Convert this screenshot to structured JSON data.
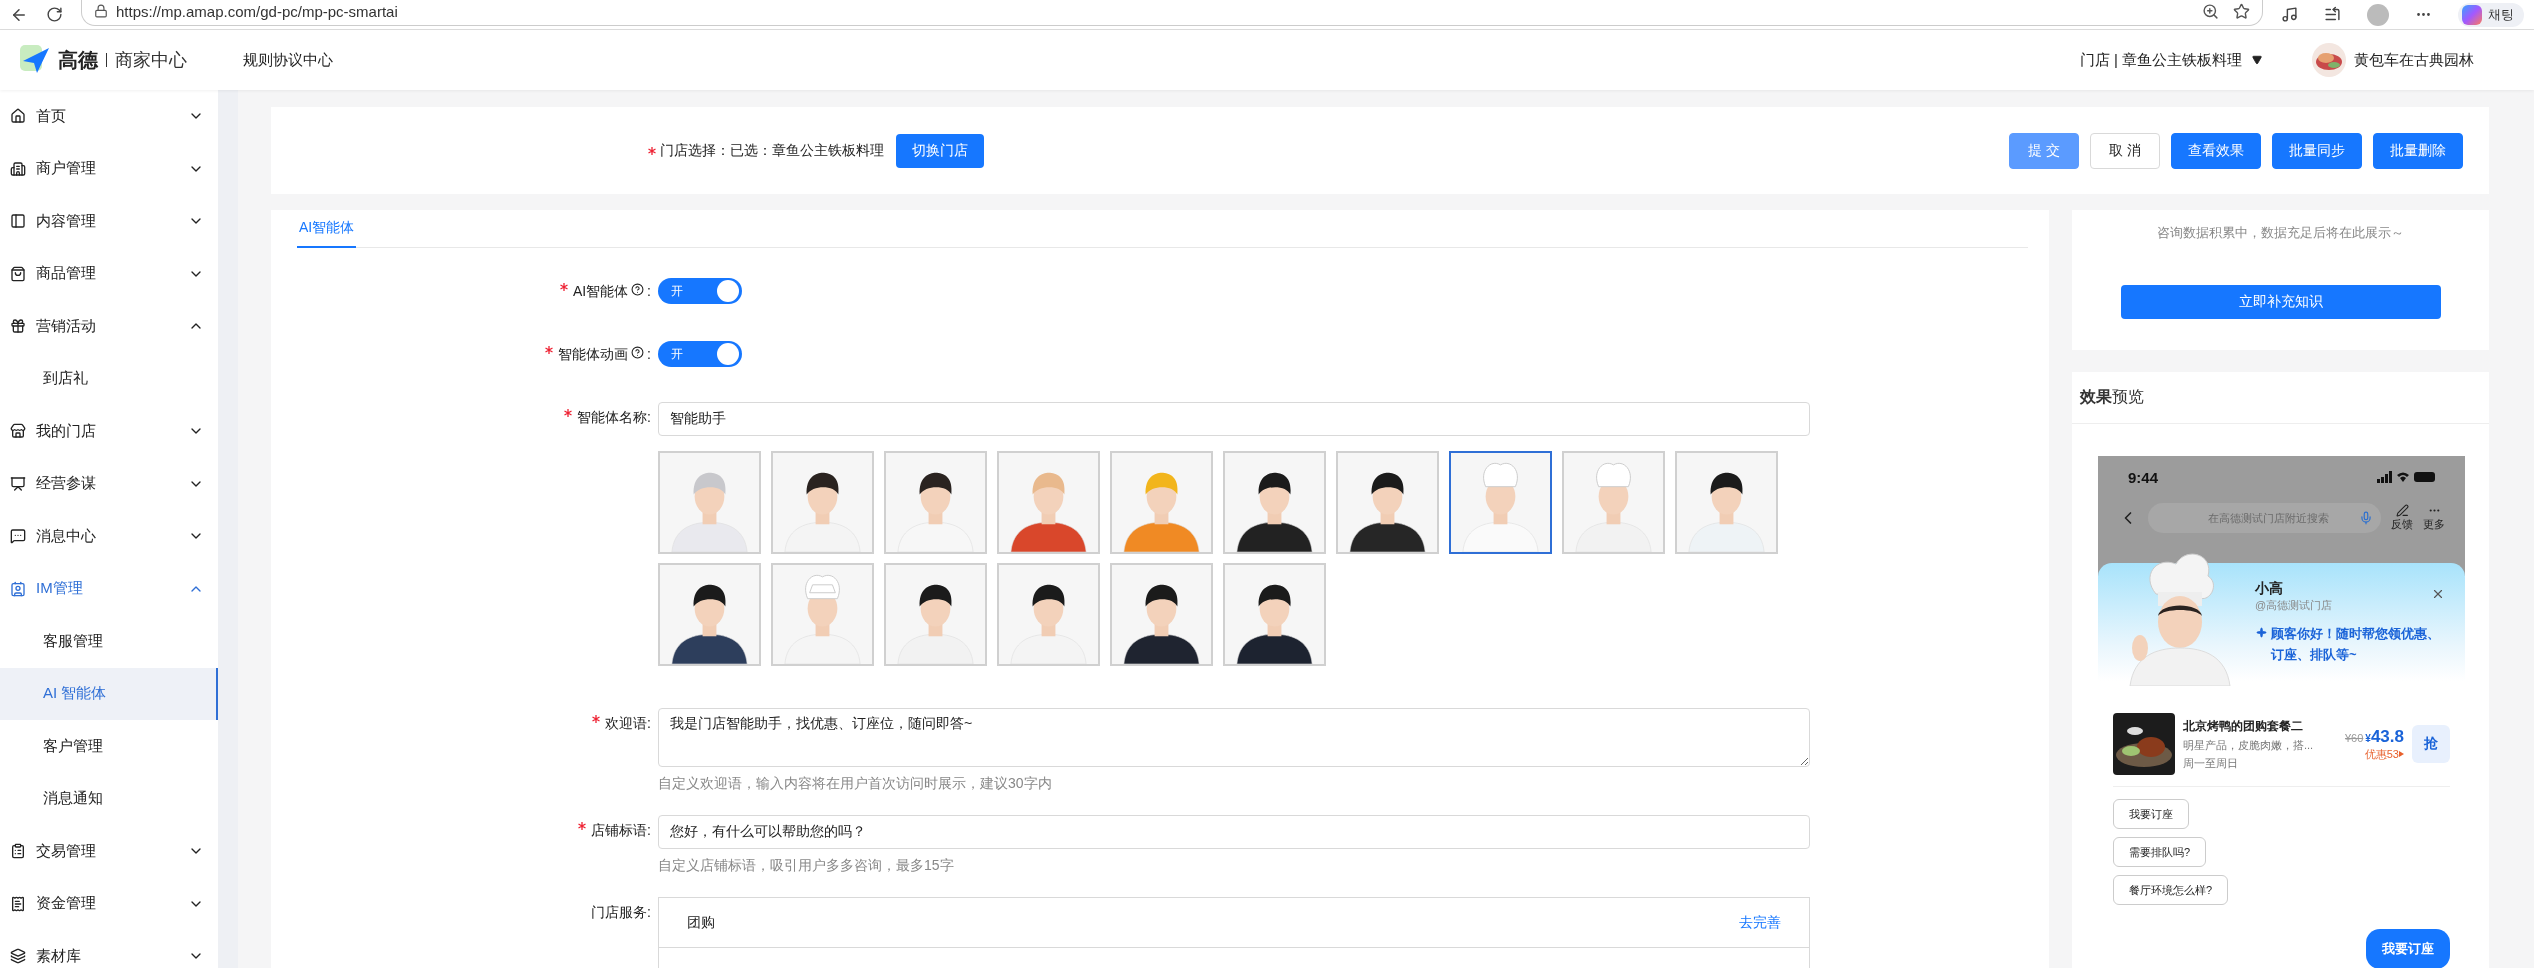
{
  "browser": {
    "url": "https://mp.amap.com/gd-pc/mp-pc-smartai",
    "chat_label": "채팅"
  },
  "header": {
    "brand": "高德",
    "product": "商家中心",
    "nav_link": "规则协议中心",
    "store_switch": {
      "label": "门店 | 章鱼公主铁板料理",
      "expanded": false
    },
    "user_name": "黄包车在古典园林"
  },
  "sidebar": {
    "items": [
      {
        "label": "首页",
        "expanded": false
      },
      {
        "label": "商户管理",
        "expanded": false
      },
      {
        "label": "内容管理",
        "expanded": false
      },
      {
        "label": "商品管理",
        "expanded": false
      },
      {
        "label": "营销活动",
        "expanded": true,
        "children": [
          {
            "label": "到店礼",
            "selected": false
          }
        ]
      },
      {
        "label": "我的门店",
        "expanded": false
      },
      {
        "label": "经营参谋",
        "expanded": false
      },
      {
        "label": "消息中心",
        "expanded": false
      },
      {
        "label": "IM管理",
        "expanded": true,
        "children": [
          {
            "label": "客服管理",
            "selected": false
          },
          {
            "label": "AI 智能体",
            "selected": true
          },
          {
            "label": "客户管理",
            "selected": false
          },
          {
            "label": "消息通知",
            "selected": false
          }
        ]
      },
      {
        "label": "交易管理",
        "expanded": false
      },
      {
        "label": "资金管理",
        "expanded": false
      },
      {
        "label": "素材库",
        "expanded": false
      }
    ]
  },
  "store_bar": {
    "required": true,
    "label": "门店选择：",
    "value": "已选：章鱼公主铁板料理",
    "switch_button": "切换门店",
    "actions": [
      {
        "label": "提 交",
        "kind": "light"
      },
      {
        "label": "取 消",
        "kind": "default"
      },
      {
        "label": "查看效果",
        "kind": "primary"
      },
      {
        "label": "批量同步",
        "kind": "primary"
      },
      {
        "label": "批量删除",
        "kind": "primary"
      }
    ]
  },
  "tabs": [
    {
      "label": "AI智能体",
      "selected": true
    }
  ],
  "form": {
    "toggles": [
      {
        "label": "AI智能体",
        "suffix": ":",
        "required": true,
        "on": true,
        "on_text": "开"
      },
      {
        "label": "智能体动画",
        "suffix": ":",
        "required": true,
        "on": true,
        "on_text": "开"
      }
    ],
    "name": {
      "label": "智能体名称:",
      "required": true,
      "value": "智能助手"
    },
    "avatars": [
      {
        "selected": false
      },
      {
        "selected": false
      },
      {
        "selected": false
      },
      {
        "selected": false
      },
      {
        "selected": false
      },
      {
        "selected": false
      },
      {
        "selected": false
      },
      {
        "selected": true
      },
      {
        "selected": false
      },
      {
        "selected": false
      },
      {
        "selected": false
      },
      {
        "selected": false
      },
      {
        "selected": false
      },
      {
        "selected": false
      },
      {
        "selected": false
      },
      {
        "selected": false
      }
    ],
    "welcome": {
      "label": "欢迎语:",
      "required": true,
      "value": "我是门店智能助手，找优惠、订座位，随问即答~",
      "hint": "自定义欢迎语，输入内容将在用户首次访问时展示，建议30字内"
    },
    "slogan": {
      "label": "店铺标语:",
      "required": true,
      "value": "您好，有什么可以帮助您的吗？",
      "hint": "自定义店铺标语，吸引用户多多咨询，最多15字"
    },
    "services": {
      "label": "门店服务:",
      "required": false,
      "rows": [
        {
          "name": "团购",
          "action": "去完善"
        }
      ]
    }
  },
  "knowledge": {
    "notice": "咨询数据积累中，数据充足后将在此展示～",
    "button": "立即补充知识"
  },
  "preview": {
    "title": "**效果**预览",
    "phone": {
      "time": "9:44",
      "search_placeholder": "在高德测试门店附近搜索",
      "nav_actions": [
        "反馈",
        "更多"
      ],
      "agent_name": "小高",
      "agent_handle": "@高德测试门店",
      "greeting": "顾客你好！随时帮您领优惠、订座、排队等~",
      "product": {
        "title": "北京烤鸭的团购套餐二",
        "desc": "明星产品，皮脆肉嫩，搭...",
        "days": "周一至周日",
        "original_price": "¥60",
        "currency": "¥",
        "price": "43.8",
        "discount": "优惠53",
        "grab": "抢"
      },
      "chips": [
        "我要订座",
        "需要排队吗?",
        "餐厅环境怎么样?"
      ],
      "cta": "我要订座"
    }
  }
}
